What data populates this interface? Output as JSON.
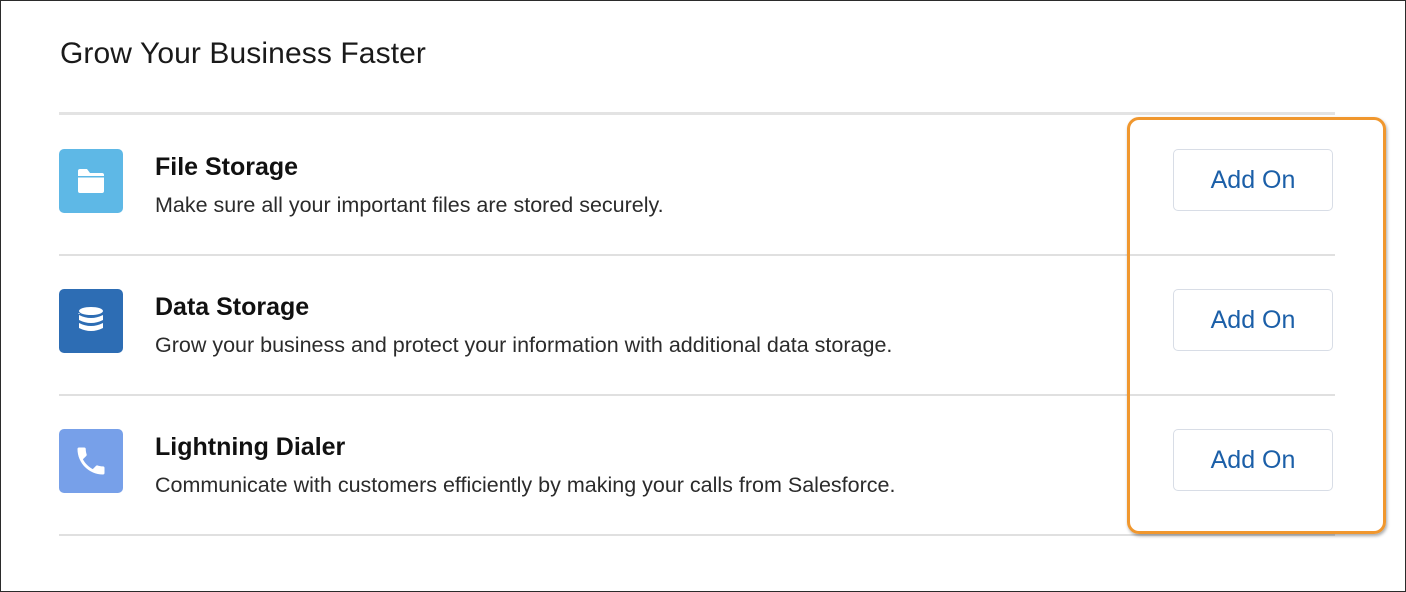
{
  "header": {
    "title": "Grow Your Business Faster"
  },
  "items": [
    {
      "title": "File Storage",
      "description": "Make sure all your important files are stored securely.",
      "icon": "folder-icon",
      "icon_color": "#5eb8e6",
      "button_label": "Add On"
    },
    {
      "title": "Data Storage",
      "description": "Grow your business and protect your information with additional data storage.",
      "icon": "database-icon",
      "icon_color": "#2d6db4",
      "button_label": "Add On"
    },
    {
      "title": "Lightning Dialer",
      "description": "Communicate with customers efficiently by making your calls from Salesforce.",
      "icon": "phone-icon",
      "icon_color": "#77a0e9",
      "button_label": "Add On"
    }
  ],
  "highlight_color": "#f0972e"
}
